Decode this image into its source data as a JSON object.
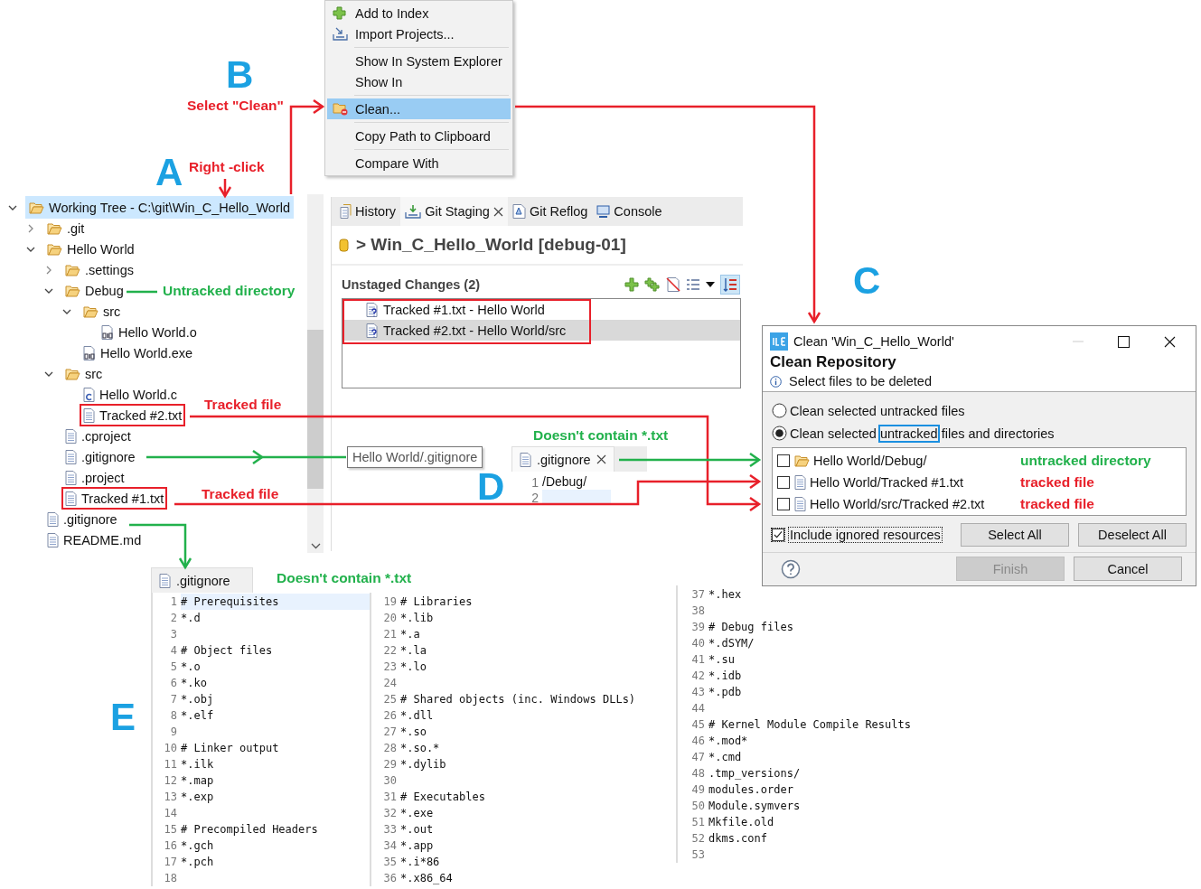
{
  "annotations": [
    {
      "kind": "letter",
      "text": "B"
    },
    {
      "kind": "red",
      "text": "Select \"Clean\""
    },
    {
      "kind": "letter",
      "text": "A"
    },
    {
      "kind": "red",
      "text": "Right -click"
    },
    {
      "kind": "letter",
      "text": "C"
    },
    {
      "kind": "green",
      "text": "Untracked directory"
    },
    {
      "kind": "red",
      "text": "Tracked file"
    },
    {
      "kind": "green",
      "text": "Doesn't contain *.txt"
    },
    {
      "kind": "letter",
      "text": "D"
    },
    {
      "kind": "red",
      "text": "Tracked file"
    },
    {
      "kind": "green",
      "text": "Doesn't contain *.txt"
    },
    {
      "kind": "letter",
      "text": "E"
    }
  ],
  "context_menu": {
    "groups": [
      [
        {
          "label": "Add to Index",
          "kind": "add",
          "selected": false
        },
        {
          "label": "Import Projects...",
          "kind": "import",
          "selected": false
        }
      ],
      [
        {
          "label": "Show In System Explorer",
          "kind": "plain",
          "selected": false
        },
        {
          "label": "Show In",
          "kind": "plain",
          "selected": false
        }
      ],
      [
        {
          "label": "Clean...",
          "kind": "clean",
          "selected": true
        }
      ],
      [
        {
          "label": "Copy Path to Clipboard",
          "kind": "plain",
          "selected": false
        }
      ],
      [
        {
          "label": "Compare With",
          "kind": "plain",
          "selected": false
        }
      ]
    ]
  },
  "tree": {
    "items": [
      {
        "label": "Working Tree - C:\\git\\Win_C_Hello_World",
        "kind": "folder",
        "expanded": true,
        "selected": true,
        "boxed": false,
        "children": [
          {
            "label": ".git",
            "kind": "folder",
            "expanded": false,
            "selected": false,
            "boxed": false
          },
          {
            "label": "Hello World",
            "kind": "folder",
            "expanded": true,
            "selected": false,
            "boxed": false,
            "children": [
              {
                "label": ".settings",
                "kind": "folder",
                "expanded": false,
                "selected": false,
                "boxed": false
              },
              {
                "label": "Debug",
                "kind": "folder",
                "expanded": true,
                "selected": false,
                "boxed": false,
                "children": [
                  {
                    "label": "src",
                    "kind": "folder",
                    "expanded": true,
                    "selected": false,
                    "boxed": false,
                    "children": [
                      {
                        "label": "Hello World.o",
                        "kind": "binary",
                        "selected": false,
                        "boxed": false
                      }
                    ]
                  },
                  {
                    "label": "Hello World.exe",
                    "kind": "binary",
                    "selected": false,
                    "boxed": false
                  }
                ]
              },
              {
                "label": "src",
                "kind": "folder",
                "expanded": true,
                "selected": false,
                "boxed": false,
                "children": [
                  {
                    "label": "Hello World.c",
                    "kind": "source",
                    "selected": false,
                    "boxed": false
                  },
                  {
                    "label": "Tracked #2.txt",
                    "kind": "text",
                    "selected": false,
                    "boxed": true
                  }
                ]
              },
              {
                "label": ".cproject",
                "kind": "text",
                "selected": false,
                "boxed": false
              },
              {
                "label": ".gitignore",
                "kind": "text",
                "selected": false,
                "boxed": false
              },
              {
                "label": ".project",
                "kind": "text",
                "selected": false,
                "boxed": false
              },
              {
                "label": "Tracked #1.txt",
                "kind": "text",
                "selected": false,
                "boxed": true
              }
            ]
          },
          {
            "label": ".gitignore",
            "kind": "text",
            "selected": false,
            "boxed": false
          },
          {
            "label": "README.md",
            "kind": "text",
            "selected": false,
            "boxed": false
          }
        ]
      }
    ]
  },
  "staging": {
    "tabs": [
      {
        "label": "History",
        "kind": "history",
        "selected": false
      },
      {
        "label": "Git Staging",
        "kind": "staging",
        "selected": true
      },
      {
        "label": "Git Reflog",
        "kind": "reflog",
        "selected": false
      },
      {
        "label": "Console",
        "kind": "console",
        "selected": false
      }
    ],
    "repo_title": "> Win_C_Hello_World [debug-01]",
    "section_title": "Unstaged Changes (2)",
    "toolbar_toggle_on": true,
    "unstaged_boxed": true,
    "unstaged": [
      {
        "label": "Tracked #1.txt - Hello World",
        "selected": false
      },
      {
        "label": "Tracked #2.txt - Hello World/src",
        "selected": true
      }
    ]
  },
  "tooltip": "Hello World/.gitignore",
  "small_editor": {
    "tab": ".gitignore",
    "lines": [
      {
        "number": "1",
        "text": "/Debug/",
        "current": false
      },
      {
        "number": "2",
        "current": true
      }
    ]
  },
  "dialog": {
    "title": "Clean 'Win_C_Hello_World'",
    "heading": "Clean Repository",
    "message": "Select files to be deleted",
    "options": [
      {
        "label": "Clean selected untracked files",
        "selected": false
      },
      {
        "label": "Clean selected ",
        "marked": "untracked",
        "label_end": " files and directories",
        "selected": true
      }
    ],
    "files": [
      {
        "path": "Hello World/Debug/",
        "kind": "folder",
        "checked": false,
        "note": "untracked directory",
        "color": "#22b14c"
      },
      {
        "path": "Hello World/Tracked #1.txt",
        "kind": "file",
        "checked": false,
        "note": "tracked file",
        "color": "#e8202a"
      },
      {
        "path": "Hello World/src/Tracked #2.txt",
        "kind": "file",
        "checked": false,
        "note": "tracked file",
        "color": "#e8202a"
      }
    ],
    "include_ignored": {
      "label": "Include ignored resources",
      "checked": true
    },
    "buttons": [
      {
        "label": "Select All",
        "disabled": false
      },
      {
        "label": "Deselect All",
        "disabled": false
      }
    ],
    "footer_buttons": [
      {
        "label": "Finish",
        "disabled": true
      },
      {
        "label": "Cancel",
        "disabled": false
      }
    ]
  },
  "editor": {
    "tab": ".gitignore",
    "columns": [
      [
        {
          "number": "1",
          "text": "# Prerequisites",
          "current": true
        },
        {
          "number": "2",
          "text": "*.d",
          "current": false
        },
        {
          "number": "3",
          "current": false
        },
        {
          "number": "4",
          "text": "# Object files",
          "current": false
        },
        {
          "number": "5",
          "text": "*.o",
          "current": false
        },
        {
          "number": "6",
          "text": "*.ko",
          "current": false
        },
        {
          "number": "7",
          "text": "*.obj",
          "current": false
        },
        {
          "number": "8",
          "text": "*.elf",
          "current": false
        },
        {
          "number": "9",
          "current": false
        },
        {
          "number": "10",
          "text": "# Linker output",
          "current": false
        },
        {
          "number": "11",
          "text": "*.ilk",
          "current": false
        },
        {
          "number": "12",
          "text": "*.map",
          "current": false
        },
        {
          "number": "13",
          "text": "*.exp",
          "current": false
        },
        {
          "number": "14",
          "current": false
        },
        {
          "number": "15",
          "text": "# Precompiled Headers",
          "current": false
        },
        {
          "number": "16",
          "text": "*.gch",
          "current": false
        },
        {
          "number": "17",
          "text": "*.pch",
          "current": false
        },
        {
          "number": "18",
          "current": false
        }
      ],
      [
        {
          "number": "19",
          "text": "# Libraries",
          "current": false
        },
        {
          "number": "20",
          "text": "*.lib",
          "current": false
        },
        {
          "number": "21",
          "text": "*.a",
          "current": false
        },
        {
          "number": "22",
          "text": "*.la",
          "current": false
        },
        {
          "number": "23",
          "text": "*.lo",
          "current": false
        },
        {
          "number": "24",
          "current": false
        },
        {
          "number": "25",
          "text": "# Shared objects (inc. Windows DLLs)",
          "current": false
        },
        {
          "number": "26",
          "text": "*.dll",
          "current": false
        },
        {
          "number": "27",
          "text": "*.so",
          "current": false
        },
        {
          "number": "28",
          "text": "*.so.*",
          "current": false
        },
        {
          "number": "29",
          "text": "*.dylib",
          "current": false
        },
        {
          "number": "30",
          "current": false
        },
        {
          "number": "31",
          "text": "# Executables",
          "current": false
        },
        {
          "number": "32",
          "text": "*.exe",
          "current": false
        },
        {
          "number": "33",
          "text": "*.out",
          "current": false
        },
        {
          "number": "34",
          "text": "*.app",
          "current": false
        },
        {
          "number": "35",
          "text": "*.i*86",
          "current": false
        },
        {
          "number": "36",
          "text": "*.x86_64",
          "current": false
        }
      ],
      [
        {
          "number": "37",
          "text": "*.hex",
          "current": false
        },
        {
          "number": "38",
          "current": false
        },
        {
          "number": "39",
          "text": "# Debug files",
          "current": false
        },
        {
          "number": "40",
          "text": "*.dSYM/",
          "current": false
        },
        {
          "number": "41",
          "text": "*.su",
          "current": false
        },
        {
          "number": "42",
          "text": "*.idb",
          "current": false
        },
        {
          "number": "43",
          "text": "*.pdb",
          "current": false
        },
        {
          "number": "44",
          "current": false
        },
        {
          "number": "45",
          "text": "# Kernel Module Compile Results",
          "current": false
        },
        {
          "number": "46",
          "text": "*.mod*",
          "current": false
        },
        {
          "number": "47",
          "text": "*.cmd",
          "current": false
        },
        {
          "number": "48",
          "text": ".tmp_versions/",
          "current": false
        },
        {
          "number": "49",
          "text": "modules.order",
          "current": false
        },
        {
          "number": "50",
          "text": "Module.symvers",
          "current": false
        },
        {
          "number": "51",
          "text": "Mkfile.old",
          "current": false
        },
        {
          "number": "52",
          "text": "dkms.conf",
          "current": false
        },
        {
          "number": "53",
          "current": false
        }
      ]
    ]
  }
}
